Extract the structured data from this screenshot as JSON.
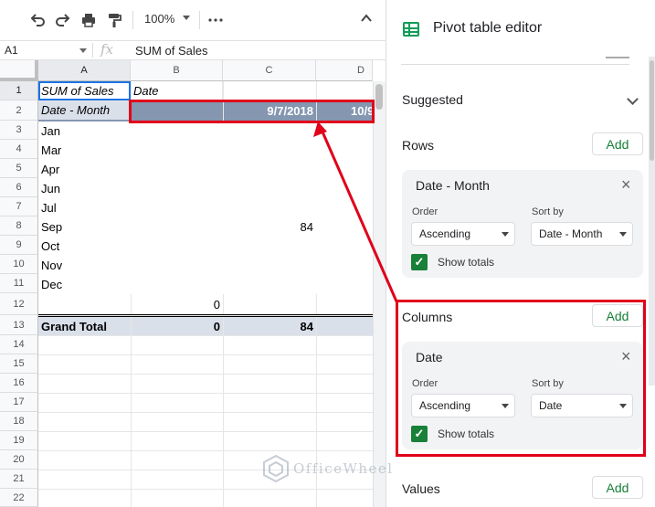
{
  "toolbar": {
    "zoom": "100%",
    "more": "⋮"
  },
  "formula_bar": {
    "cell_ref": "A1",
    "fx": "fx",
    "content": "SUM of Sales"
  },
  "grid": {
    "columns": [
      "A",
      "B",
      "C",
      "D"
    ],
    "rows": [
      "1",
      "2",
      "3",
      "4",
      "5",
      "6",
      "7",
      "8",
      "9",
      "10",
      "11",
      "12",
      "13",
      "14",
      "15",
      "16",
      "17",
      "18",
      "19",
      "20",
      "21",
      "22"
    ],
    "cells": {
      "A1": "SUM of Sales",
      "B1": "Date",
      "A2": "Date - Month",
      "C2": "9/7/2018",
      "D2": "10/9",
      "A3": "Jan",
      "A4": "Mar",
      "A5": "Apr",
      "A6": "Jun",
      "A7": "Jul",
      "A8": "Sep",
      "C8": "84",
      "A9": "Oct",
      "A10": "Nov",
      "A11": "Dec",
      "B12": "0",
      "A13": "Grand Total",
      "B13": "0",
      "C13": "84"
    }
  },
  "panel": {
    "title": "Pivot table editor",
    "suggested": "Suggested",
    "rows_label": "Rows",
    "columns_label": "Columns",
    "values_label": "Values",
    "add_label": "Add",
    "row_card": {
      "title": "Date - Month",
      "order_label": "Order",
      "order_value": "Ascending",
      "sort_label": "Sort by",
      "sort_value": "Date - Month",
      "show_totals": "Show totals"
    },
    "column_card": {
      "title": "Date",
      "order_label": "Order",
      "order_value": "Ascending",
      "sort_label": "Sort by",
      "sort_value": "Date",
      "show_totals": "Show totals"
    }
  },
  "watermark": "OfficeWheel",
  "colors": {
    "accent_green": "#188038",
    "header_band": "#8496b0",
    "annotation_red": "#e0001a"
  }
}
